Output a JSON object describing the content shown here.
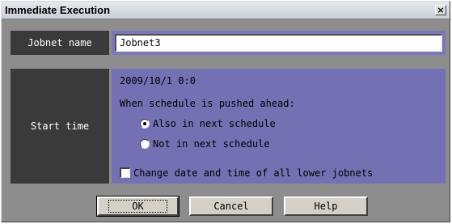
{
  "window": {
    "title": "Immediate Execution",
    "close_glyph": "×"
  },
  "jobnet": {
    "label": "Jobnet name",
    "value": "Jobnet3"
  },
  "start_time": {
    "label": "Start time",
    "datetime": "2009/10/1 0:0",
    "schedule_heading": "When schedule is pushed ahead:",
    "options": [
      {
        "label": "Also in next schedule",
        "selected": true
      },
      {
        "label": "Not in next schedule",
        "selected": false
      }
    ],
    "checkbox_label": "Change date and time of all lower jobnets",
    "checkbox_checked": false
  },
  "buttons": {
    "ok": "OK",
    "cancel": "Cancel",
    "help": "Help"
  },
  "colors": {
    "label_bg": "#3a3a3a",
    "panel_bg": "#7371b3",
    "dialog_bg": "#8d8d8d"
  }
}
